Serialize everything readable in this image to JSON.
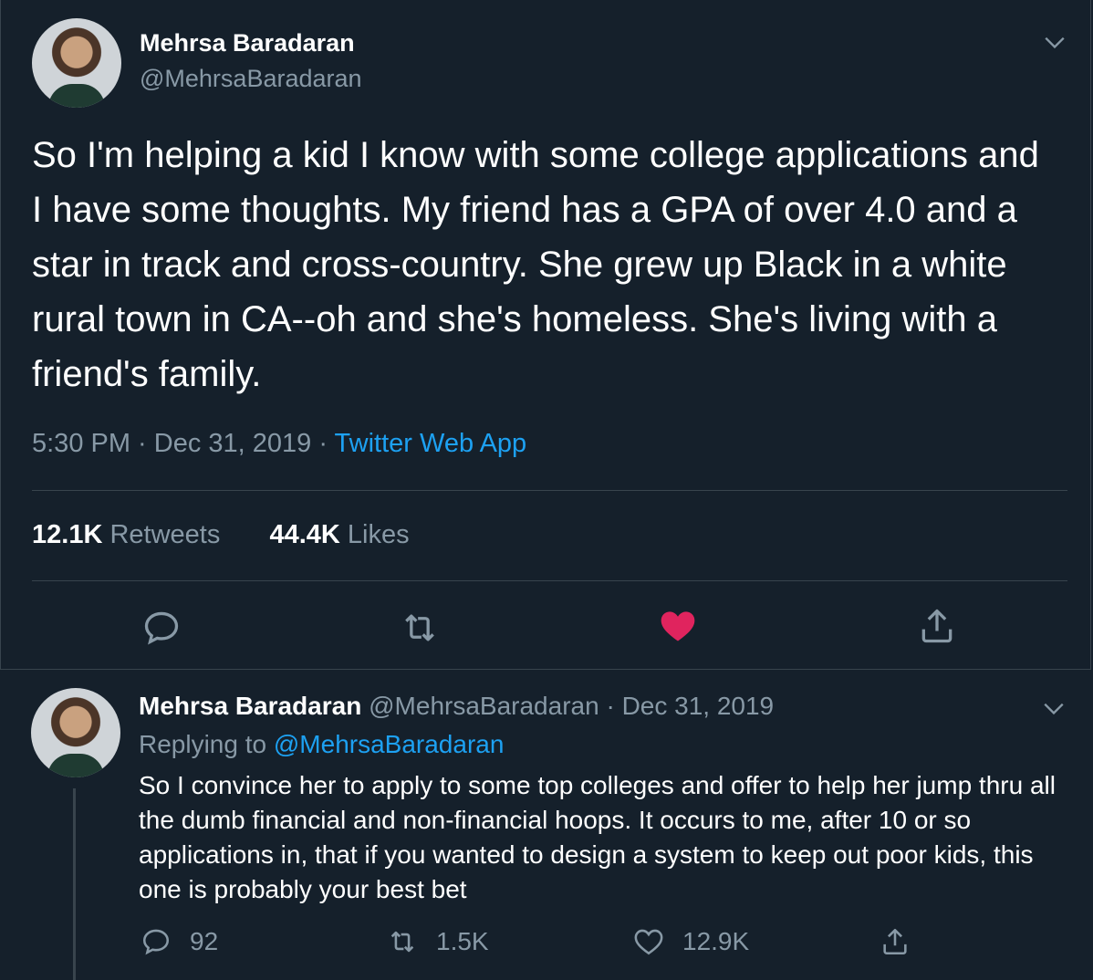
{
  "main_tweet": {
    "author_name": "Mehrsa Baradaran",
    "author_handle": "@MehrsaBaradaran",
    "text": "So I'm helping a kid I know with some college applications and I have some thoughts. My friend has a GPA of over 4.0 and a star in track and cross-country. She grew up Black in a white rural town in CA--oh and she's homeless. She's living with a friend's family.",
    "time": "5:30 PM",
    "separator": " · ",
    "date": "Dec 31, 2019",
    "app": "Twitter Web App",
    "retweets_count": "12.1K",
    "retweets_label": " Retweets",
    "likes_count": "44.4K",
    "likes_label": " Likes",
    "liked": true,
    "icons": [
      "reply-icon",
      "retweet-icon",
      "like-icon",
      "share-icon"
    ]
  },
  "reply_tweet": {
    "author_name": "Mehrsa Baradaran",
    "author_handle": "@MehrsaBaradaran",
    "separator": " · ",
    "date": "Dec 31, 2019",
    "replying_label": "Replying to ",
    "replying_to": "@MehrsaBaradaran",
    "text": "So I convince her to apply to some top colleges and offer to help her jump thru all the dumb financial and non-financial hoops. It occurs to me, after 10 or so applications in, that if you wanted to design a system to keep out poor kids, this one is probably your best bet",
    "reply_count": "92",
    "retweet_count": "1.5K",
    "like_count": "12.9K"
  },
  "colors": {
    "background": "#15202b",
    "border": "#38444d",
    "secondary_text": "#8899a6",
    "link": "#1da1f2",
    "like": "#e0245e"
  }
}
